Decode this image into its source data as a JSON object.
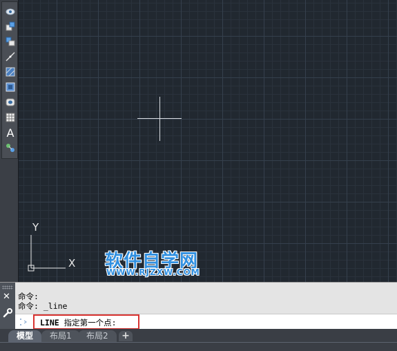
{
  "toolbar": {
    "tools": [
      {
        "name": "view-cloud-icon"
      },
      {
        "name": "insert-block-icon"
      },
      {
        "name": "make-block-icon"
      },
      {
        "name": "point-icon"
      },
      {
        "name": "hatch-icon"
      },
      {
        "name": "gradient-icon"
      },
      {
        "name": "region-icon"
      },
      {
        "name": "table-icon"
      },
      {
        "name": "multiline-text-icon",
        "glyph": "A"
      },
      {
        "name": "add-selected-icon"
      }
    ]
  },
  "canvas": {
    "background": "#212830",
    "ucs": {
      "x_label": "X",
      "y_label": "Y"
    }
  },
  "watermark": {
    "title": "软件自学网",
    "url": "WWW.RJZXW.COM",
    "color": "#2f8fe0"
  },
  "command": {
    "history": [
      "命令:",
      "命令: _line"
    ],
    "prompt_command": "LINE",
    "prompt_text": " 指定第一个点:",
    "highlight_color": "#d8322f"
  },
  "tabs": [
    {
      "label": "模型",
      "active": true
    },
    {
      "label": "布局1",
      "active": false
    },
    {
      "label": "布局2",
      "active": false
    }
  ],
  "tab_add_label": "+"
}
